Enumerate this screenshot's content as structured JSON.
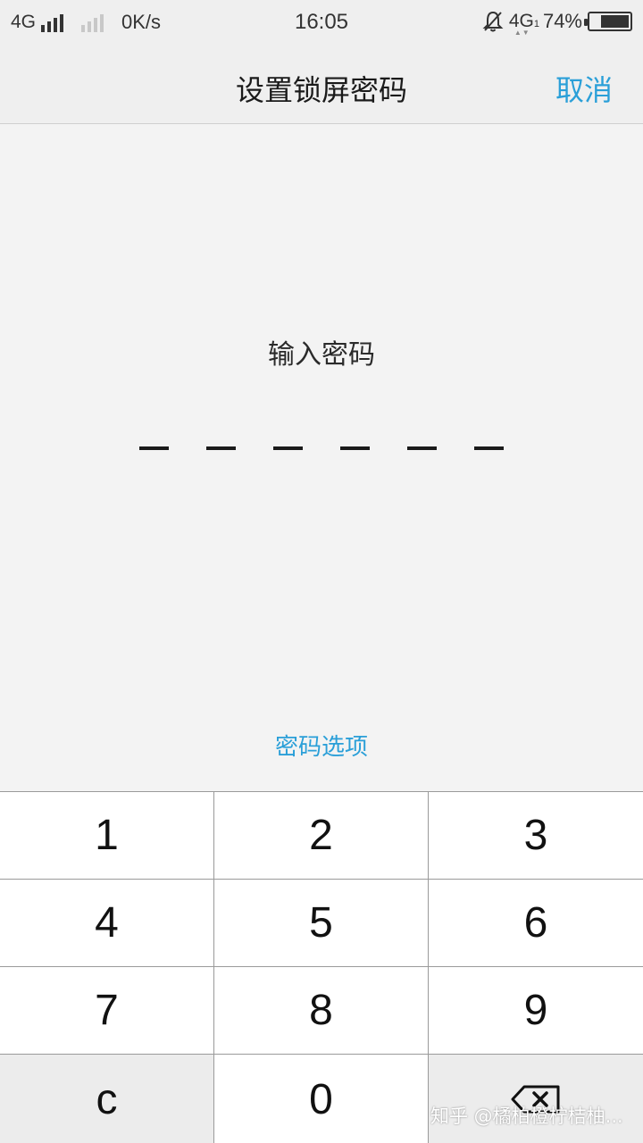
{
  "status_bar": {
    "network_left": "4G",
    "speed": "0K/s",
    "time": "16:05",
    "network_right": "4G",
    "network_right_sub": "1",
    "battery_text": "74%",
    "battery_level": 0.74
  },
  "header": {
    "title": "设置锁屏密码",
    "cancel_label": "取消"
  },
  "main": {
    "prompt": "输入密码",
    "pin_length": 6,
    "pin_entered": 0,
    "options_label": "密码选项"
  },
  "keypad": {
    "keys": [
      "1",
      "2",
      "3",
      "4",
      "5",
      "6",
      "7",
      "8",
      "9",
      "c",
      "0"
    ],
    "delete_icon": "backspace-icon"
  },
  "watermark": "知乎 @橘柏橙柠桔柚...",
  "colors": {
    "accent": "#2a9fd8",
    "background": "#f3f3f3",
    "key_background": "#ffffff",
    "function_key_background": "#ececec"
  }
}
